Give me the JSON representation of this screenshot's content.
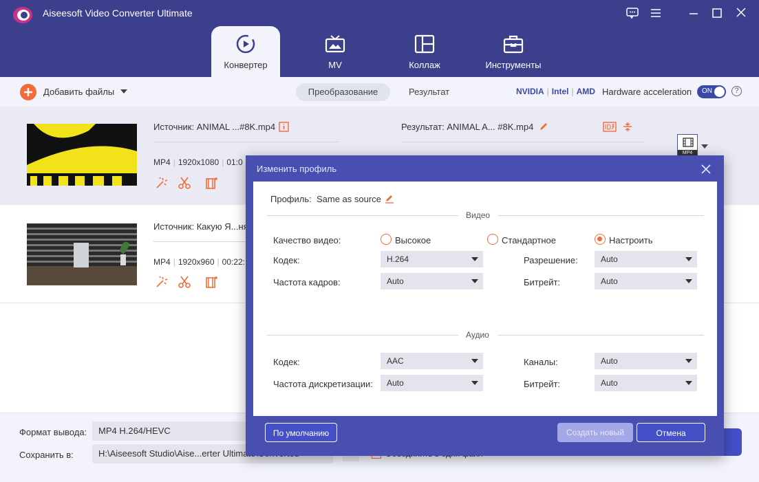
{
  "app": {
    "title": "Aiseesoft Video Converter Ultimate"
  },
  "tabs": [
    {
      "label": "Конвертер",
      "icon": "converter-icon",
      "active": true
    },
    {
      "label": "MV",
      "icon": "tv-icon"
    },
    {
      "label": "Коллаж",
      "icon": "collage-icon"
    },
    {
      "label": "Инструменты",
      "icon": "toolbox-icon"
    }
  ],
  "toolbar": {
    "add_files": "Добавить файлы",
    "convert_tab": "Преобразование",
    "result_tab": "Результат",
    "hw_vendors": [
      "NVIDIA",
      "Intel",
      "AMD"
    ],
    "hw_label": "Hardware acceleration",
    "hw_toggle": "ON",
    "help": "?"
  },
  "files": [
    {
      "source": "Источник: ANIMAL ...#8K.mp4",
      "format": "MP4",
      "resolution": "1920x1080",
      "duration": "01:0",
      "result": "Результат: ANIMAL A... #8K.mp4",
      "output_badge": "MP4"
    },
    {
      "source": "Источник: Какую Я...ня",
      "format": "MP4",
      "resolution": "1920x960",
      "duration": "00:22:"
    }
  ],
  "bottom": {
    "format_label": "Формат вывода:",
    "format_value": "MP4 H.264/HEVC",
    "save_label": "Сохранить в:",
    "save_value": "H:\\Aiseesoft Studio\\Aise...erter Ultimate\\Converted",
    "merge_label": "Объединить в один файл"
  },
  "dialog": {
    "title": "Изменить профиль",
    "profile_label": "Профиль:",
    "profile_value": "Same as source",
    "video_section": "Видео",
    "audio_section": "Аудио",
    "video": {
      "quality_label": "Качество видео:",
      "quality_options": [
        "Высокое",
        "Стандартное",
        "Настроить"
      ],
      "quality_selected": 2,
      "codec_label": "Кодек:",
      "codec_value": "H.264",
      "framerate_label": "Частота кадров:",
      "framerate_value": "Auto",
      "resolution_label": "Разрешение:",
      "resolution_value": "Auto",
      "bitrate_label": "Битрейт:",
      "bitrate_value": "Auto"
    },
    "audio": {
      "codec_label": "Кодек:",
      "codec_value": "AAC",
      "samplerate_label": "Частота дискретизации:",
      "samplerate_value": "Auto",
      "channels_label": "Каналы:",
      "channels_value": "Auto",
      "bitrate_label": "Битрейт:",
      "bitrate_value": "Auto"
    },
    "btn_default": "По умолчанию",
    "btn_create": "Создать новый",
    "btn_cancel": "Отмена"
  },
  "colors": {
    "header": "#3b3f8c",
    "accent": "#f26b3a",
    "primary": "#4550c8"
  }
}
